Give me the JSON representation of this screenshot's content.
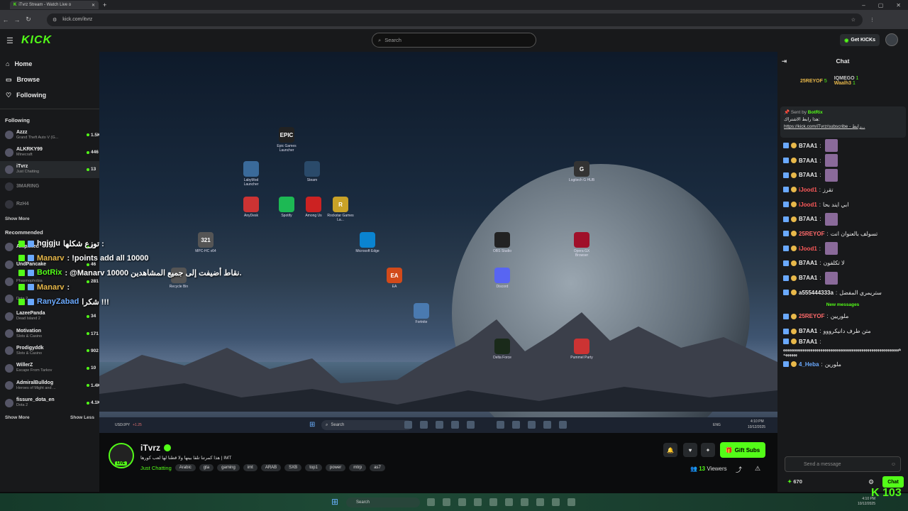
{
  "browser": {
    "tab_title": "iTvrz Stream - Watch Live o",
    "url": "kick.com/itvrz"
  },
  "header": {
    "logo": "KICK",
    "search_placeholder": "Search",
    "get_kicks": "Get KICKs"
  },
  "nav": {
    "home": "Home",
    "browse": "Browse",
    "following": "Following"
  },
  "following": {
    "title": "Following",
    "channels": [
      {
        "name": "Azzz",
        "game": "Grand Theft Auto V (G...",
        "viewers": "1.5K"
      },
      {
        "name": "ALKRKY99",
        "game": "Minecraft",
        "viewers": "446"
      },
      {
        "name": "iTvrz",
        "game": "Just Chatting",
        "viewers": "13"
      },
      {
        "name": "3MARING",
        "game": "",
        "viewers": ""
      },
      {
        "name": "RzH4",
        "game": "",
        "viewers": ""
      }
    ],
    "show_more": "Show More"
  },
  "recommended": {
    "title": "Recommended",
    "channels": [
      {
        "name": "Amplified",
        "game": "",
        "viewers": "82"
      },
      {
        "name": "UndPancake",
        "game": "",
        "viewers": "46"
      },
      {
        "name": "",
        "game": "Phasmophobia",
        "viewers": "281"
      },
      {
        "name": "",
        "game": "Dota 2",
        "viewers": ""
      },
      {
        "name": "LazeePanda",
        "game": "Dead Island 2",
        "viewers": "34"
      },
      {
        "name": "Motivation",
        "game": "Slots & Casino",
        "viewers": "171"
      },
      {
        "name": "Prodigyddk",
        "game": "Slots & Casino",
        "viewers": "902"
      },
      {
        "name": "WillerZ",
        "game": "Escape From Tarkov",
        "viewers": "10"
      },
      {
        "name": "AdmiralBulldog",
        "game": "Heroes of Might and ...",
        "viewers": "1.4K"
      },
      {
        "name": "fissure_dota_en",
        "game": "Dota 2",
        "viewers": "4.1K"
      }
    ],
    "show_more": "Show More",
    "show_less": "Show Less"
  },
  "overlay_chat": [
    {
      "user": "hgjgju",
      "text": "توزع شكلها :",
      "color": "#ffffff"
    },
    {
      "user": "Manarv",
      "text": ": !points add all 10000",
      "color": "#e8b84a"
    },
    {
      "user": "BotRix",
      "text": ": @Manarv 10000 نقاط أضيفت إلى جميع المشاهدين.",
      "color": "#53fc18"
    },
    {
      "user": "Manarv",
      "text": ":",
      "color": "#e8b84a"
    },
    {
      "user": "RanyZabad",
      "text": "شكرا !!!",
      "color": "#6aa9ff"
    }
  ],
  "desktop_icons": [
    {
      "label": "Epic Games Launcher",
      "glyph": "EPIC"
    },
    {
      "label": "LabyMod Launcher",
      "glyph": ""
    },
    {
      "label": "Steam",
      "glyph": ""
    },
    {
      "label": "AnyDesk",
      "glyph": ""
    },
    {
      "label": "Spotify",
      "glyph": ""
    },
    {
      "label": "Among Us",
      "glyph": ""
    },
    {
      "label": "Rockstar Games La...",
      "glyph": "R"
    },
    {
      "label": "MPC-HC x64",
      "glyph": "321"
    },
    {
      "label": "Microsoft Edge",
      "glyph": ""
    },
    {
      "label": "Recycle Bin",
      "glyph": ""
    },
    {
      "label": "EA",
      "glyph": "EA"
    },
    {
      "label": "Fortnite",
      "glyph": ""
    },
    {
      "label": "Delta Force",
      "glyph": ""
    },
    {
      "label": "Discord",
      "glyph": ""
    },
    {
      "label": "OBS Studio",
      "glyph": ""
    },
    {
      "label": "Logitech G HUB",
      "glyph": "G"
    },
    {
      "label": "Opera GX Browser",
      "glyph": ""
    },
    {
      "label": "Pummel Party",
      "glyph": ""
    }
  ],
  "inner_taskbar": {
    "ticker": "USD/JPY",
    "ticker_value": "+1.25",
    "search": "Search",
    "lang": "ENG",
    "time": "4:10 PM",
    "date": "10/12/2025"
  },
  "stream": {
    "streamer": "iTvrz",
    "live": "LIVE",
    "title": "هذا كمرتنا تلقا بينها ولا قطنا لها لعب كورها | IMT",
    "category": "Just Chatting",
    "tags": [
      "Arabic",
      "gta",
      "gaming",
      "imt",
      "ARAB",
      "SXB",
      "top1",
      "power",
      "mtrp",
      "as7"
    ],
    "gift_subs": "Gift Subs",
    "viewers": "13",
    "viewers_label": "Viewers"
  },
  "chat": {
    "title": "Chat",
    "leaderboard": [
      {
        "name": "25REYOF",
        "value": "5",
        "color": "#e8b84a"
      },
      {
        "name": "IQMEGO",
        "value": "1",
        "color": "#cccccc"
      },
      {
        "name": "Waalh3",
        "value": "1",
        "color": "#e8b84a"
      }
    ],
    "pinned": {
      "sent_by": "Sent by",
      "bot": "BotRix",
      "text": "هذا رابط الاشتراك:",
      "link": "https://kick.com/iTvrz/subscribe - رابط..."
    },
    "messages": [
      {
        "user": "B7AA1",
        "text": "",
        "color": "#e8e8e8"
      },
      {
        "user": "B7AA1",
        "text": "",
        "color": "#e8e8e8"
      },
      {
        "user": "B7AA1",
        "text": "",
        "color": "#e8e8e8"
      },
      {
        "user": "iJood1",
        "text": "تقرز",
        "color": "#ff5a5a"
      },
      {
        "user": "iJood1",
        "text": "ابي ايند بحا",
        "color": "#ff5a5a"
      },
      {
        "user": "B7AA1",
        "text": "",
        "color": "#e8e8e8"
      },
      {
        "user": "25REYOF",
        "text": "تسولف بالعنوان انت",
        "color": "#ff6a6a"
      },
      {
        "user": "iJood1",
        "text": "",
        "color": "#ff5a5a"
      },
      {
        "user": "B7AA1",
        "text": "لا تكلفون",
        "color": "#e8e8e8"
      },
      {
        "user": "B7AA1",
        "text": "",
        "color": "#e8e8e8"
      },
      {
        "user": "a555444333a",
        "text": "ستريمري المفضل",
        "color": "#e8e8e8"
      }
    ],
    "new_messages": "New messages",
    "new": [
      {
        "user": "25REYOF",
        "text": "ملوريين",
        "color": "#ff6a6a"
      },
      {
        "user": "B7AA1",
        "text": "متن طرف دانيكرووو",
        "color": "#e8e8e8"
      },
      {
        "user": "B7AA1",
        "text": "ههههههههههههههههههههههههههههههههههههههههههههههههههههههههههههههههههه",
        "color": "#e8e8e8"
      },
      {
        "user": "4_Heba",
        "text": "ملورين",
        "color": "#6aa9ff"
      }
    ],
    "send_placeholder": "Send a message",
    "points": "670",
    "chat_button": "Chat"
  },
  "overlay_counter": "103",
  "os_taskbar": {
    "search": "Search",
    "time": "4:10 PM",
    "date": "10/12/2025"
  }
}
